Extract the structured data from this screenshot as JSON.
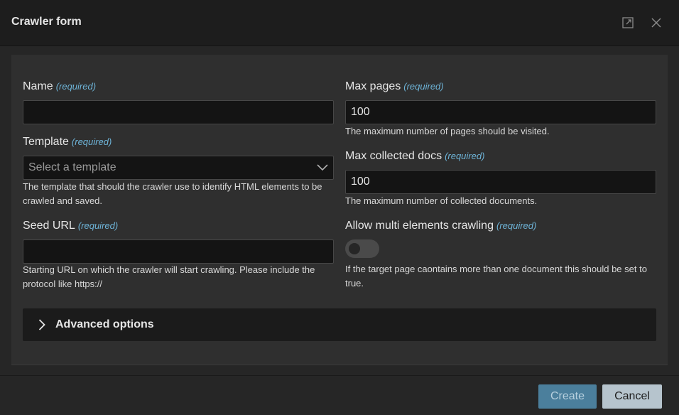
{
  "dialog": {
    "title": "Crawler form",
    "icons": {
      "maximize": "expand-icon",
      "close": "close-icon"
    }
  },
  "form": {
    "required_text": "(required)",
    "name": {
      "label": "Name",
      "value": "",
      "placeholder": ""
    },
    "template": {
      "label": "Template",
      "placeholder": "Select a template",
      "help": "The template that should the crawler use to identify HTML elements to be crawled and saved."
    },
    "seed_url": {
      "label": "Seed URL",
      "value": "",
      "help": "Starting URL on which the crawler will start crawling. Please include the protocol like https://"
    },
    "max_pages": {
      "label": "Max pages",
      "value": "100",
      "help": "The maximum number of pages should be visited."
    },
    "max_docs": {
      "label": "Max collected docs",
      "value": "100",
      "help": "The maximum number of collected documents."
    },
    "multi": {
      "label": "Allow multi elements crawling",
      "enabled": false,
      "help": "If the target page caontains more than one document this should be set to true."
    },
    "advanced": {
      "label": "Advanced options"
    }
  },
  "footer": {
    "create_label": "Create",
    "cancel_label": "Cancel"
  },
  "colors": {
    "accent": "#4b7f9c",
    "required": "#6eb4d8",
    "header_bg": "#1d1d1d",
    "panel_bg": "#2f2f2f"
  }
}
